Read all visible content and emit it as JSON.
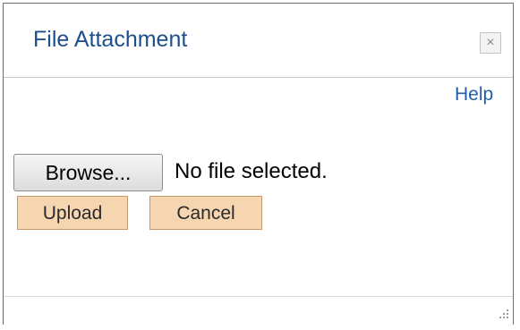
{
  "dialog": {
    "title": "File Attachment",
    "close_glyph": "×",
    "help_label": "Help"
  },
  "file_input": {
    "browse_label": "Browse...",
    "status_text": "No file selected."
  },
  "actions": {
    "upload_label": "Upload",
    "cancel_label": "Cancel"
  },
  "icons": {
    "close": "close-icon",
    "resize": "resize-grip-icon"
  },
  "colors": {
    "title_text": "#1f4e8c",
    "link": "#1f5fa8",
    "action_button_bg": "#f6d6b0",
    "action_button_border": "#c49a6c"
  }
}
